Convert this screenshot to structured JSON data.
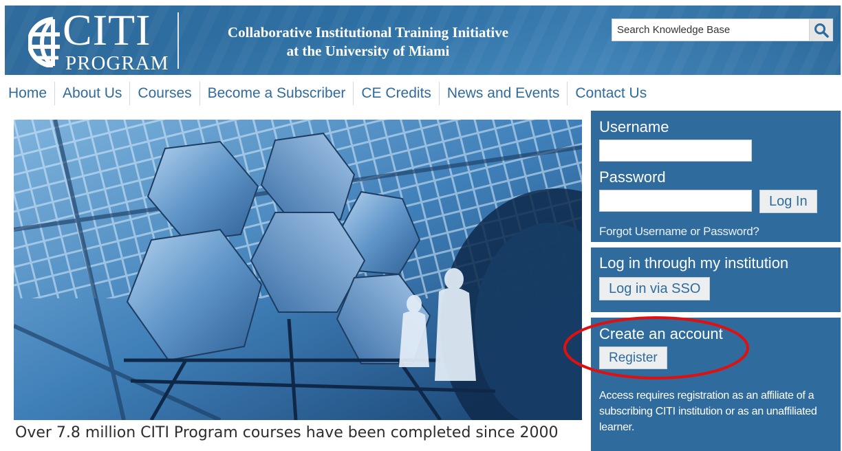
{
  "header": {
    "logo_title": "CITI",
    "logo_subtitle": "PROGRAM",
    "tagline_line1": "Collaborative Institutional Training Initiative",
    "tagline_line2": "at the University of Miami",
    "search": {
      "placeholder": "Search Knowledge Base",
      "button_icon": "search-icon"
    }
  },
  "nav": {
    "items": [
      {
        "label": "Home"
      },
      {
        "label": "About Us"
      },
      {
        "label": "Courses"
      },
      {
        "label": "Become a Subscriber"
      },
      {
        "label": "CE Credits"
      },
      {
        "label": "News and Events"
      },
      {
        "label": "Contact Us"
      }
    ]
  },
  "hero": {
    "caption": "Over 7.8 million CITI Program courses have been completed since 2000"
  },
  "login": {
    "username_label": "Username",
    "username_value": "",
    "password_label": "Password",
    "password_value": "",
    "login_button": "Log In",
    "forgot_link": "Forgot Username or Password?"
  },
  "sso": {
    "heading": "Log in through my institution",
    "button": "Log in via SSO"
  },
  "register": {
    "heading": "Create an account",
    "button": "Register",
    "note": "Access requires registration as an affiliate of a subscribing CITI institution or as an unaffiliated learner."
  },
  "colors": {
    "brand_blue": "#2f6b9c",
    "annotation_red": "#e01010"
  }
}
